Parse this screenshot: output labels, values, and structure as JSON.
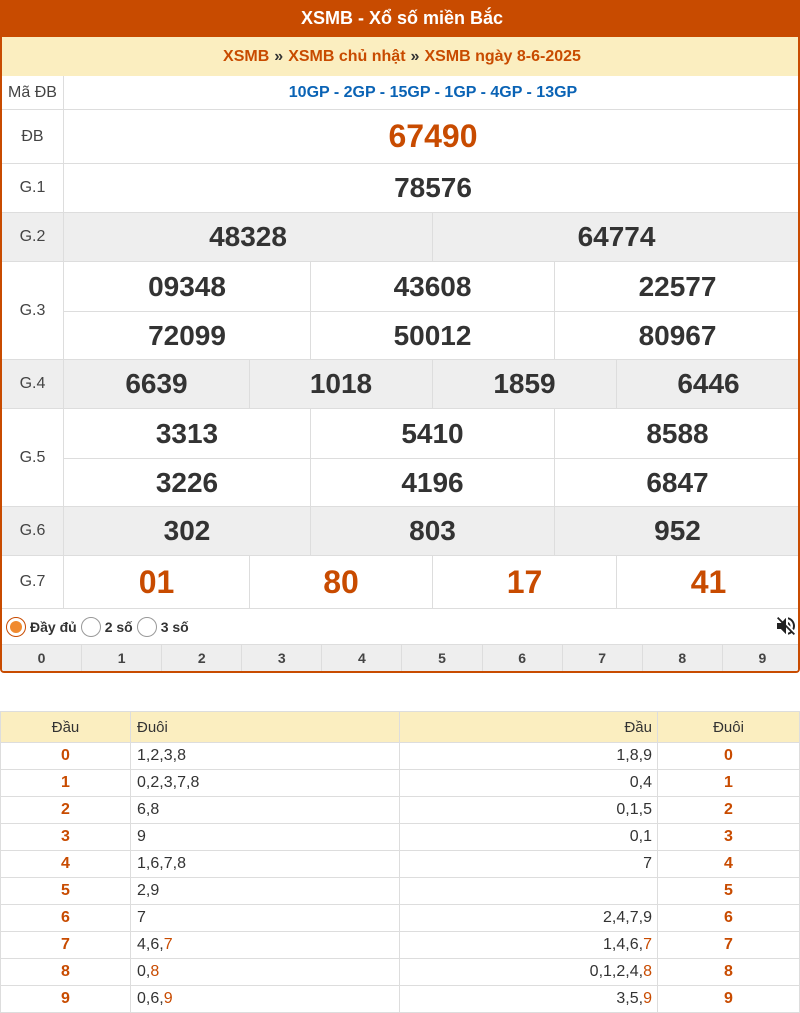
{
  "title": "XSMB - Xổ số miền Bắc",
  "breadcrumb": {
    "item1": "XSMB",
    "sep": "»",
    "item2": "XSMB chủ nhật",
    "item3": "XSMB ngày 8-6-2025"
  },
  "prizes": {
    "ma_db_label": "Mã ĐB",
    "ma_db_value": "10GP - 2GP - 15GP - 1GP - 4GP - 13GP",
    "db_label": "ĐB",
    "db": "67490",
    "g1_label": "G.1",
    "g1": "78576",
    "g2_label": "G.2",
    "g2": [
      "48328",
      "64774"
    ],
    "g3_label": "G.3",
    "g3": [
      "09348",
      "43608",
      "22577",
      "72099",
      "50012",
      "80967"
    ],
    "g4_label": "G.4",
    "g4": [
      "6639",
      "1018",
      "1859",
      "6446"
    ],
    "g5_label": "G.5",
    "g5": [
      "3313",
      "5410",
      "8588",
      "3226",
      "4196",
      "6847"
    ],
    "g6_label": "G.6",
    "g6": [
      "302",
      "803",
      "952"
    ],
    "g7_label": "G.7",
    "g7": [
      "01",
      "80",
      "17",
      "41"
    ]
  },
  "options": {
    "full": "Đầy đủ",
    "two": "2 số",
    "three": "3 số",
    "selected": "full"
  },
  "icons": {
    "mute": "speaker-muted-icon"
  },
  "digits": [
    "0",
    "1",
    "2",
    "3",
    "4",
    "5",
    "6",
    "7",
    "8",
    "9"
  ],
  "loto": {
    "headers": {
      "dau": "Đầu",
      "duoi": "Đuôi",
      "dau2": "Đầu",
      "duoi2": "Đuôi"
    },
    "rows": [
      {
        "dau": "0",
        "duoi": "1,2,3,8",
        "dau2": "1,8,9",
        "duoi2": "0"
      },
      {
        "dau": "1",
        "duoi": "0,2,3,7,8",
        "dau2": "0,4",
        "duoi2": "1"
      },
      {
        "dau": "2",
        "duoi": "6,8",
        "dau2": "0,1,5",
        "duoi2": "2"
      },
      {
        "dau": "3",
        "duoi": "9",
        "dau2": "0,1",
        "duoi2": "3"
      },
      {
        "dau": "4",
        "duoi": "1,6,7,8",
        "dau2": "7",
        "duoi2": "4"
      },
      {
        "dau": "5",
        "duoi": "2,9",
        "dau2": "",
        "duoi2": "5"
      },
      {
        "dau": "6",
        "duoi": "7",
        "dau2": "2,4,7,9",
        "duoi2": "6"
      },
      {
        "dau": "7",
        "duoi": "4,6,7",
        "dau2": "1,4,6,7",
        "duoi2": "7"
      },
      {
        "dau": "8",
        "duoi": "0,8",
        "dau2": "0,1,2,4,8",
        "duoi2": "8"
      },
      {
        "dau": "9",
        "duoi": "0,6,9",
        "dau2": "3,5,9",
        "duoi2": "9"
      }
    ]
  },
  "colors": {
    "accent": "#c84b00",
    "header_bg": "#fbeec0",
    "code_blue": "#0a63b5"
  }
}
